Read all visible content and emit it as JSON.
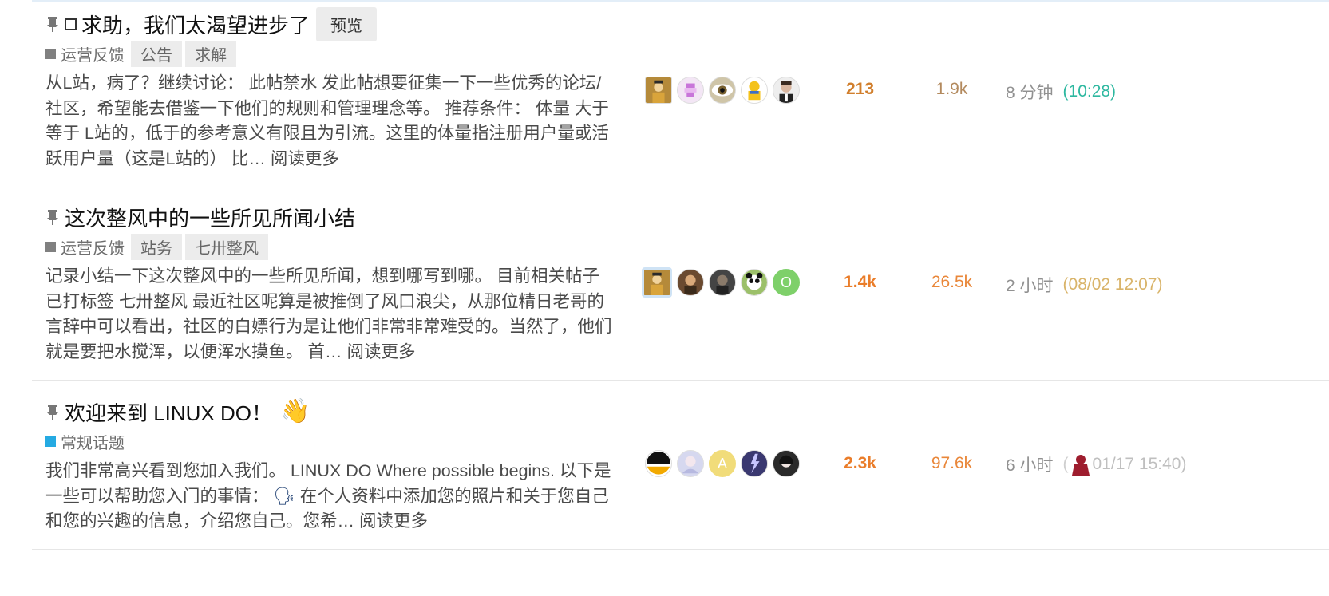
{
  "colors": {
    "cat_ops": "#808080",
    "cat_general": "#25aae2",
    "replies_low": "#d17f2d",
    "replies_high": "#ea7d2a",
    "views_low": "#b38a5e",
    "views_high": "#e9873a",
    "date_teal": "#2eb8a0",
    "date_gold": "#d9b46a"
  },
  "topics": [
    {
      "title": "求助，我们太渴望进步了",
      "preview_label": "预览",
      "category": "运营反馈",
      "tags": [
        "公告",
        "求解"
      ],
      "excerpt": "从L站，病了？继续讨论： 此帖禁水 发此帖想要征集一下一些优秀的论坛/社区，希望能去借鉴一下他们的规则和管理理念等。 推荐条件： 体量 大于等于 L站的，低于的参考意义有限且为引流。这里的体量指注册用户量或活跃用户量（这是L站的） 比…",
      "read_more": "阅读更多",
      "replies": "213",
      "views": "1.9k",
      "activity": "8 分钟",
      "activity_date": "(10:28)"
    },
    {
      "title": "这次整风中的一些所见所闻小结",
      "category": "运营反馈",
      "tags": [
        "站务",
        "七卅整风"
      ],
      "excerpt": "记录小结一下这次整风中的一些所见所闻，想到哪写到哪。 目前相关帖子已打标签 七卅整风 最近社区呢算是被推倒了风口浪尖，从那位精日老哥的言辞中可以看出，社区的白嫖行为是让他们非常非常难受的。当然了，他们就是要把水搅浑，以便浑水摸鱼。 首…",
      "read_more": "阅读更多",
      "replies": "1.4k",
      "views": "26.5k",
      "activity": "2 小时",
      "activity_date": "(08/02 12:07)",
      "avatar_letter": "O"
    },
    {
      "title": "欢迎来到 LINUX DO！",
      "emoji": "👋",
      "category": "常规话题",
      "excerpt_part1": "我们非常高兴看到您加入我们。 LINUX DO Where possible begins. 以下是一些可以帮助您入门的事情： ",
      "excerpt_emoji": "🗣",
      "excerpt_part2": " 在个人资料中添加您的照片和关于您自己和您的兴趣的信息，介绍您自己。您希…",
      "read_more": "阅读更多",
      "replies": "2.3k",
      "views": "97.6k",
      "activity": "6 小时",
      "activity_open": "(",
      "activity_date": "01/17 15:40)",
      "avatar_letter": "A"
    }
  ]
}
